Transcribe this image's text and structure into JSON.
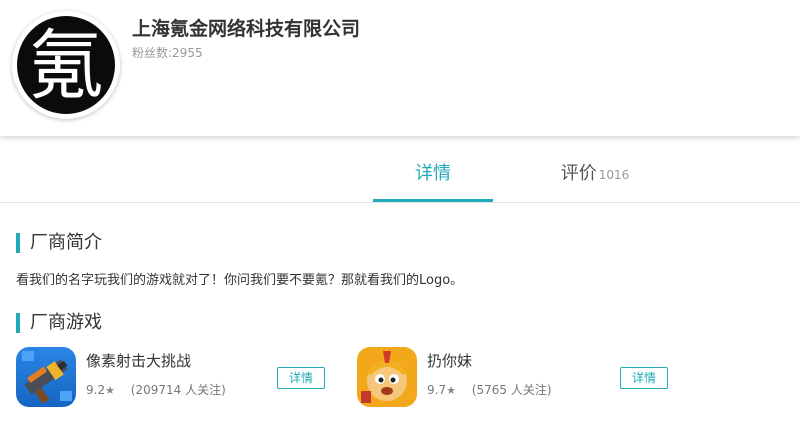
{
  "company": {
    "avatar_glyph": "氪",
    "name": "上海氪金网络科技有限公司",
    "fans": "粉丝数:2955"
  },
  "tabs": [
    {
      "label": "详情",
      "active": true
    },
    {
      "label": "评价",
      "count": "1016",
      "active": false
    }
  ],
  "intro": {
    "title": "厂商简介",
    "text": "看我们的名字玩我们的游戏就对了！你问我们要不要氪？那就看我们的Logo。"
  },
  "games_section": {
    "title": "厂商游戏",
    "games": [
      {
        "name": "像素射击大挑战",
        "rating": "9.2",
        "follow": "(209714 人关注)",
        "button": "详情",
        "icon": "pixel-gun-game-icon"
      },
      {
        "name": "扔你妹",
        "rating": "9.7",
        "follow": "(5765 人关注)",
        "button": "详情",
        "icon": "warrior-face-game-icon"
      }
    ]
  },
  "colors": {
    "accent": "#20a9b8"
  }
}
